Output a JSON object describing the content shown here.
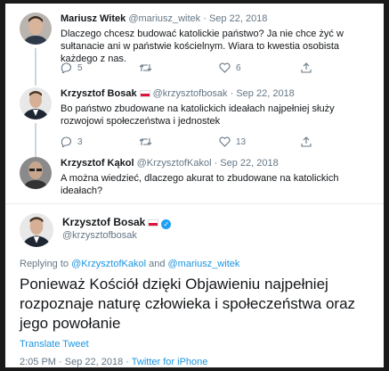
{
  "tweets": [
    {
      "name": "Mariusz Witek",
      "handle": "@mariusz_witek",
      "date": "· Sep 22, 2018",
      "text": "Dlaczego chcesz budować katolickie państwo? Ja nie chce żyć w sułtanacie ani w państwie kościelnym. Wiara to kwestia osobista każdego z nas.",
      "replies": "5",
      "retweets": "",
      "likes": "6"
    },
    {
      "name": "Krzysztof Bosak",
      "handle": "@krzysztofbosak",
      "date": "· Sep 22, 2018",
      "text": "Bo państwo zbudowane na katolickich ideałach najpełniej służy rozwojowi społeczeństwa i jednostek",
      "replies": "3",
      "retweets": "",
      "likes": "13"
    },
    {
      "name": "Krzysztof Kąkol",
      "handle": "@KrzysztofKakol",
      "date": "· Sep 22, 2018",
      "text": "A można wiedzieć, dlaczego akurat to zbudowane na katolickich ideałach?",
      "replies": "",
      "retweets": "",
      "likes": ""
    }
  ],
  "main_tweet": {
    "name": "Krzysztof Bosak",
    "handle": "@krzysztofbosak",
    "replying_prefix": "Replying to",
    "replying_user1": "@KrzysztofKakol",
    "replying_and": "and",
    "replying_user2": "@mariusz_witek",
    "text": "Ponieważ Kościół dzięki Objawieniu najpełniej rozpoznaje naturę człowieka i społeczeństwa oraz jego powołanie",
    "translate": "Translate Tweet",
    "time": "2:05 PM",
    "date": "· Sep 22, 2018 ·",
    "source": "Twitter for iPhone"
  },
  "colors": {
    "accent": "#1b95e0",
    "verified": "#1da1f2",
    "flag_red": "#dc143c"
  },
  "icons": [
    "reply-icon",
    "retweet-icon",
    "like-icon",
    "share-icon",
    "verified-icon",
    "flag-icon"
  ]
}
